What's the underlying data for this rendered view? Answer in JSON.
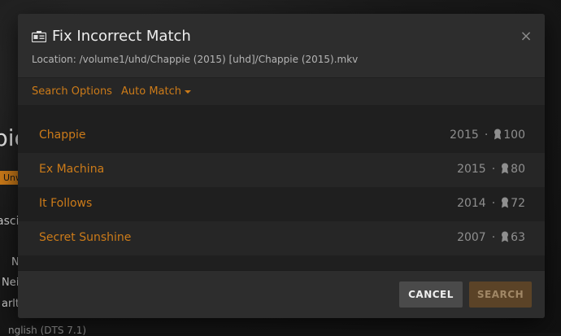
{
  "background": {
    "big_text": "pie",
    "badge": "Unw",
    "line1": "asci",
    "line2": "N",
    "line3": "Neil",
    "line4": "arlt",
    "line5": "nglish (DTS 7.1)"
  },
  "modal": {
    "title": "Fix Incorrect Match",
    "location": "Location: /volume1/uhd/Chappie (2015) [uhd]/Chappie (2015).mkv",
    "close_glyph": "×"
  },
  "toolbar": {
    "search_options": "Search Options",
    "auto_match": "Auto Match"
  },
  "results": [
    {
      "title": "Chappie",
      "year": "2015",
      "score": "100"
    },
    {
      "title": "Ex Machina",
      "year": "2015",
      "score": "80"
    },
    {
      "title": "It Follows",
      "year": "2014",
      "score": "72"
    },
    {
      "title": "Secret Sunshine",
      "year": "2007",
      "score": "63"
    }
  ],
  "separator": "·",
  "footer": {
    "cancel_label": "CANCEL",
    "search_label": "SEARCH"
  },
  "colors": {
    "accent": "#cc7b19",
    "modal_bg": "#282828"
  }
}
